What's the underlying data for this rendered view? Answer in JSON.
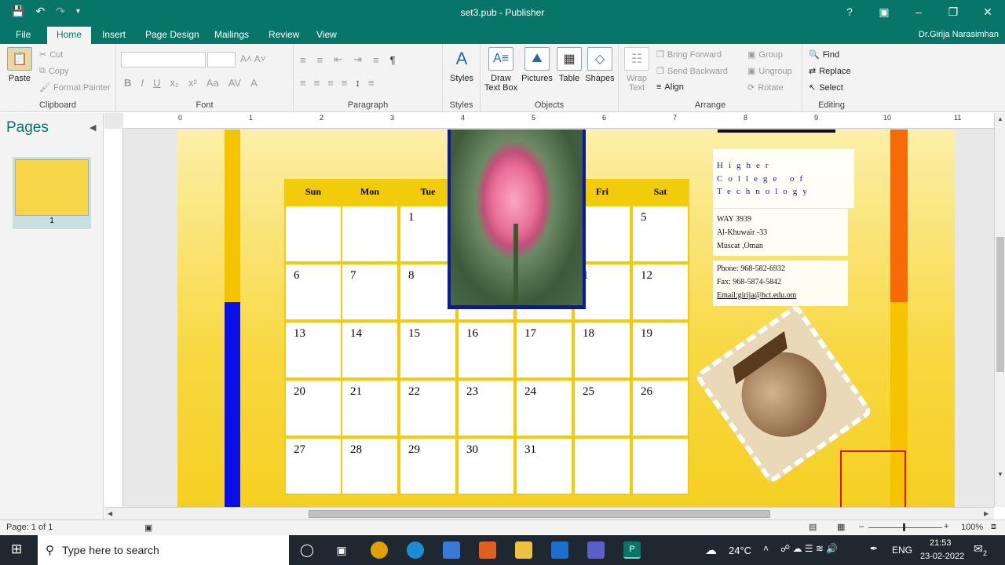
{
  "app": {
    "title": "set3.pub - Publisher",
    "user": "Dr.Girija Narasimhan",
    "help": "?"
  },
  "tabs": [
    "File",
    "Home",
    "Insert",
    "Page Design",
    "Mailings",
    "Review",
    "View"
  ],
  "ribbon": {
    "clipboard": {
      "label": "Clipboard",
      "paste": "Paste",
      "cut": "Cut",
      "copy": "Copy",
      "format_painter": "Format Painter"
    },
    "font": {
      "label": "Font"
    },
    "paragraph": {
      "label": "Paragraph"
    },
    "styles": {
      "label": "Styles",
      "button": "Styles"
    },
    "objects": {
      "label": "Objects",
      "draw_text_box_1": "Draw",
      "draw_text_box_2": "Text Box",
      "pictures": "Pictures",
      "table": "Table",
      "shapes": "Shapes"
    },
    "arrange": {
      "label": "Arrange",
      "wrap_text_1": "Wrap",
      "wrap_text_2": "Text",
      "bring_forward": "Bring Forward",
      "send_backward": "Send Backward",
      "align": "Align",
      "group": "Group",
      "ungroup": "Ungroup",
      "rotate": "Rotate"
    },
    "editing": {
      "label": "Editing",
      "find": "Find",
      "replace": "Replace",
      "select": "Select"
    }
  },
  "pages_pane": {
    "title": "Pages",
    "thumb_number": "1"
  },
  "ruler": [
    "0",
    "1",
    "2",
    "3",
    "4",
    "5",
    "6",
    "7",
    "8",
    "9",
    "10",
    "11"
  ],
  "calendar": {
    "days": [
      "Sun",
      "Mon",
      "Tue",
      "Wed",
      "Thu",
      "Fri",
      "Sat"
    ],
    "rows": [
      [
        "",
        "",
        "1",
        "",
        "",
        "",
        "5"
      ],
      [
        "6",
        "7",
        "8",
        "",
        "",
        "1",
        "12"
      ],
      [
        "13",
        "14",
        "15",
        "16",
        "17",
        "18",
        "19"
      ],
      [
        "20",
        "21",
        "22",
        "23",
        "24",
        "25",
        "26"
      ],
      [
        "27",
        "28",
        "29",
        "30",
        "31",
        "",
        ""
      ]
    ]
  },
  "address": {
    "line1": "Higher",
    "line2": "College of",
    "line3": "Technology",
    "way": "WAY 3939",
    "area": "Al-Khuwair -33",
    "city": "Muscat ,Oman",
    "phone": "Phone: 968-582-6932",
    "fax": "Fax: 968-5874-5842",
    "email": "Email:girija@hct.edu.om"
  },
  "status": {
    "page": "Page: 1 of 1",
    "zoom": "100%"
  },
  "taskbar": {
    "search_placeholder": "Type here to search",
    "weather": "24°C",
    "lang": "ENG",
    "time": "21:53",
    "date": "23-02-2022",
    "notif": "2"
  }
}
